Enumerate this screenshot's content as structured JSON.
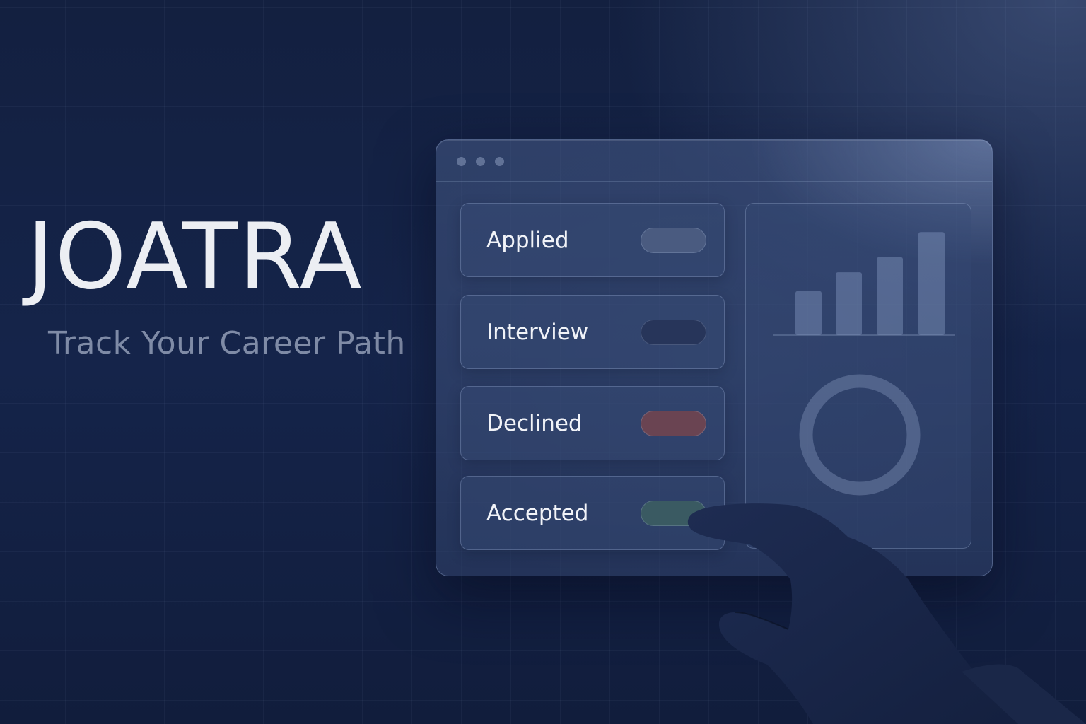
{
  "brand": {
    "title": "JOATRA",
    "tagline": "Track Your Career Path"
  },
  "window": {
    "controls": [
      "window-dot",
      "window-dot",
      "window-dot"
    ]
  },
  "statuses": [
    {
      "label": "Applied",
      "pill_color": "#4a5b80"
    },
    {
      "label": "Interview",
      "pill_color": "#27355a"
    },
    {
      "label": "Declined",
      "pill_color": "#6a4452"
    },
    {
      "label": "Accepted",
      "pill_color": "#3a5a62"
    }
  ],
  "chart_data": [
    {
      "type": "bar",
      "categories": [
        "",
        "",
        "",
        ""
      ],
      "values": [
        35,
        50,
        62,
        82
      ],
      "ylim": [
        0,
        90
      ]
    },
    {
      "type": "pie",
      "values": [
        100
      ],
      "style": "ring"
    }
  ],
  "colors": {
    "background": "#15244a",
    "accent_text": "#eceef3",
    "tagline": "#7f8ba6"
  },
  "icons": {
    "pointer": "hand-pointer-icon"
  }
}
